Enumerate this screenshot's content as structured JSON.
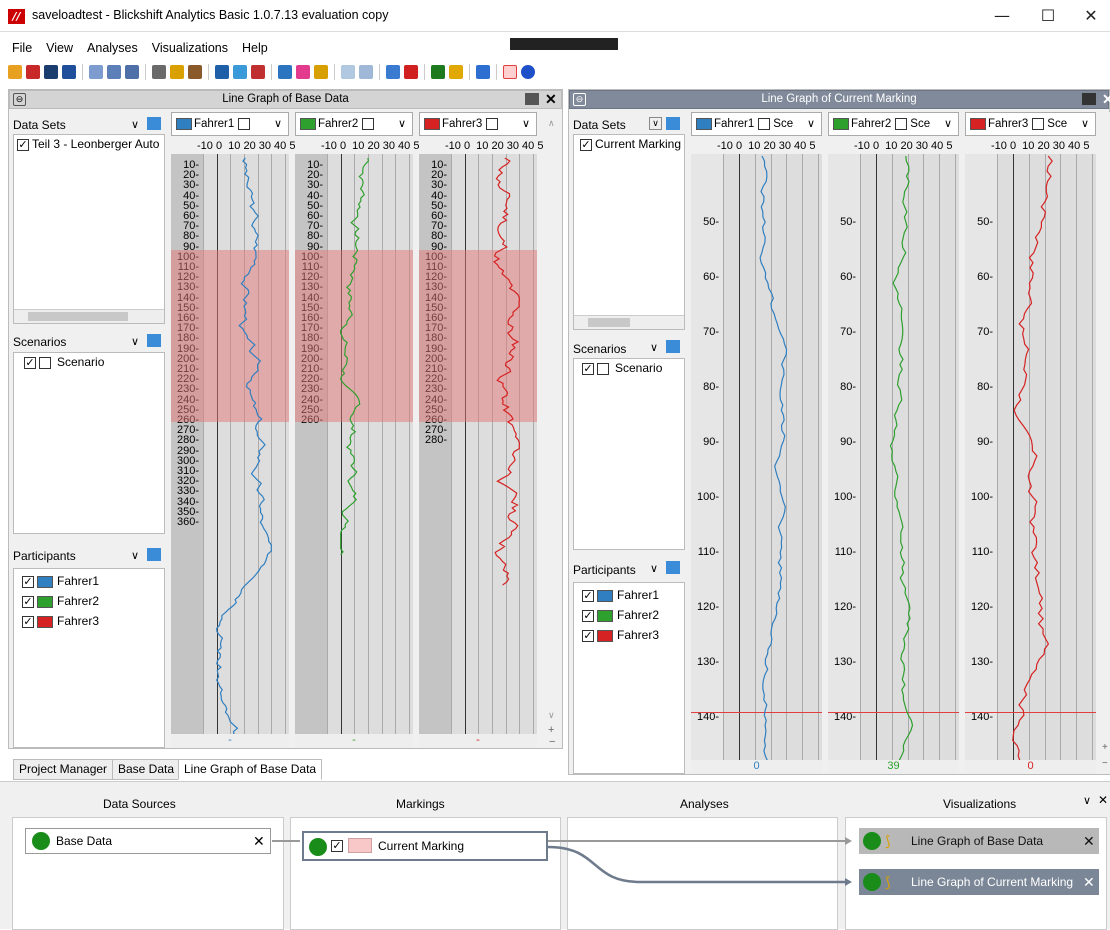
{
  "window": {
    "title": "saveloadtest - Blickshift Analytics Basic 1.0.7.13 evaluation copy",
    "icon_text": "//",
    "min": "—",
    "max": "☐",
    "close": "✕"
  },
  "menu": [
    "File",
    "View",
    "Analyses",
    "Visualizations",
    "Help"
  ],
  "left_panel": {
    "title": "Line Graph of Base Data",
    "data_sets_label": "Data Sets",
    "data_set_item": "Teil 3 - Leonberger Auto",
    "scenarios_label": "Scenarios",
    "scenario_item": "Scenario",
    "participants_label": "Participants",
    "participants": [
      {
        "name": "Fahrer1",
        "color": "#2f7fc1"
      },
      {
        "name": "Fahrer2",
        "color": "#2ea02e"
      },
      {
        "name": "Fahrer3",
        "color": "#d62222"
      }
    ],
    "columns": [
      {
        "name": "Fahrer1",
        "footer": "-",
        "footer_color": "#2f7fc1"
      },
      {
        "name": "Fahrer2",
        "footer": "-",
        "footer_color": "#2ea02e"
      },
      {
        "name": "Fahrer3",
        "footer": "-",
        "footer_color": "#d62222"
      }
    ],
    "x_ticks": "-10 0  10 20 30 40 5",
    "y_ticks": [
      "10",
      "20",
      "30",
      "40",
      "50",
      "60",
      "70",
      "80",
      "90",
      "100",
      "110",
      "120",
      "130",
      "140",
      "150",
      "160",
      "170",
      "180",
      "190",
      "200",
      "210",
      "220",
      "230",
      "240",
      "250",
      "260",
      "270",
      "280",
      "290",
      "300",
      "310",
      "320",
      "330",
      "340",
      "350",
      "360"
    ],
    "marking_range": [
      40,
      150
    ]
  },
  "right_panel": {
    "title": "Line Graph of Current Marking",
    "data_sets_label": "Data Sets",
    "data_set_item": "Current Marking",
    "scenarios_label": "Scenarios",
    "scenario_item": "Scenario",
    "participants_label": "Participants",
    "columns": [
      {
        "name": "Fahrer1",
        "sub": "Sce",
        "footer": "0",
        "footer_color": "#2f7fc1"
      },
      {
        "name": "Fahrer2",
        "sub": "Sce",
        "footer": "39",
        "footer_color": "#2ea02e"
      },
      {
        "name": "Fahrer3",
        "sub": "Sce",
        "footer": "0",
        "footer_color": "#d62222"
      }
    ],
    "x_ticks": "-10 0  10 20 30 40 5",
    "y_ticks": [
      "50",
      "60",
      "70",
      "80",
      "90",
      "100",
      "110",
      "120",
      "130",
      "140"
    ],
    "cursor_value": 137
  },
  "tabs": [
    "Project Manager",
    "Base Data",
    "Line Graph of Base Data"
  ],
  "flow": {
    "headers": [
      "Data Sources",
      "Markings",
      "Analyses",
      "Visualizations"
    ],
    "source": "Base Data",
    "marking": "Current Marking",
    "vis": [
      "Line Graph of Base Data",
      "Line Graph of Current Marking"
    ],
    "marking_color": "#f8c8c8"
  }
}
